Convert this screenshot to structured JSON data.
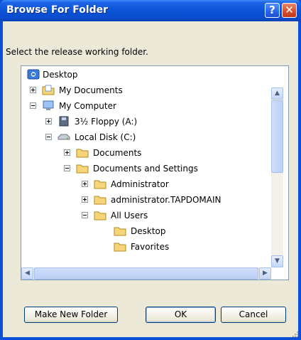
{
  "window": {
    "title": "Browse For Folder",
    "help_glyph": "?",
    "close_glyph": "✕",
    "prompt": "Select the release working folder."
  },
  "tree": {
    "items": [
      {
        "label": "Desktop",
        "icon": "desktop-icon",
        "expander": "none"
      },
      {
        "label": "My Documents",
        "icon": "my-documents-icon",
        "expander": "plus"
      },
      {
        "label": "My Computer",
        "icon": "computer-icon",
        "expander": "minus"
      },
      {
        "label": "3½ Floppy (A:)",
        "icon": "floppy-drive-icon",
        "expander": "plus"
      },
      {
        "label": "Local Disk (C:)",
        "icon": "hard-disk-icon",
        "expander": "minus"
      },
      {
        "label": "Documents",
        "icon": "folder-icon",
        "expander": "plus"
      },
      {
        "label": "Documents and Settings",
        "icon": "folder-icon",
        "expander": "minus"
      },
      {
        "label": "Administrator",
        "icon": "folder-icon",
        "expander": "plus"
      },
      {
        "label": "administrator.TAPDOMAIN",
        "icon": "folder-icon",
        "expander": "plus"
      },
      {
        "label": "All Users",
        "icon": "folder-icon",
        "expander": "minus"
      },
      {
        "label": "Desktop",
        "icon": "folder-icon",
        "expander": "none"
      },
      {
        "label": "Favorites",
        "icon": "folder-icon",
        "expander": "none"
      }
    ]
  },
  "buttons": {
    "new_folder": "Make New Folder",
    "ok": "OK",
    "cancel": "Cancel"
  },
  "colors": {
    "titlebar": "#0a4fd6",
    "dialog_face": "#ece9d8",
    "folder": "#f6d57a",
    "close_button": "#d8502e"
  }
}
